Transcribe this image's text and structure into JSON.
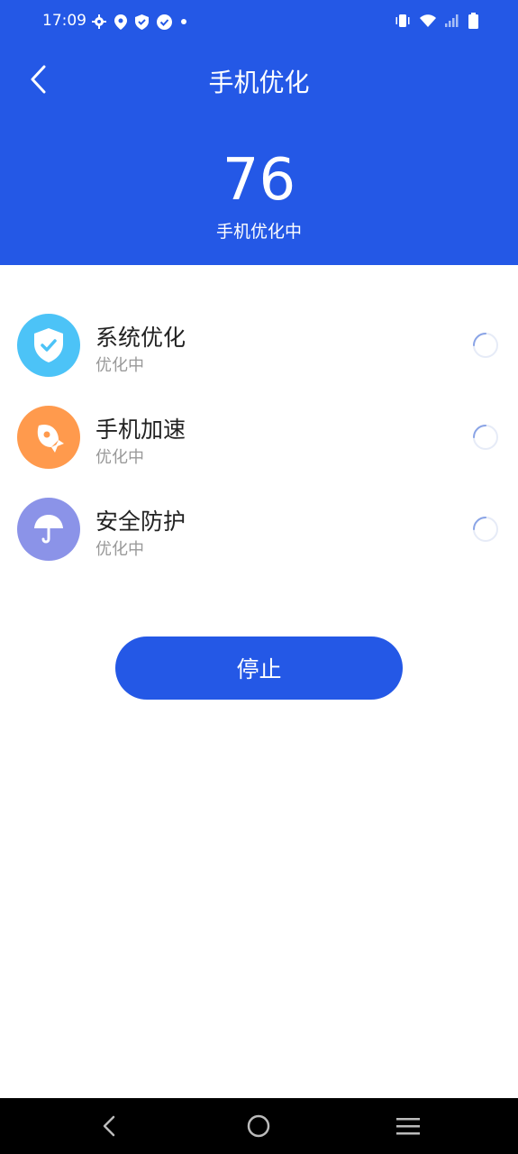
{
  "status_bar": {
    "time": "17:09"
  },
  "header": {
    "title": "手机优化",
    "score": "76",
    "score_caption": "手机优化中"
  },
  "items": [
    {
      "title": "系统优化",
      "status": "优化中",
      "icon": "shield-check-icon",
      "color": "#4cc3f7"
    },
    {
      "title": "手机加速",
      "status": "优化中",
      "icon": "rocket-icon",
      "color": "#ff9a4d"
    },
    {
      "title": "安全防护",
      "status": "优化中",
      "icon": "umbrella-icon",
      "color": "#8b93e8"
    }
  ],
  "stop_button": {
    "label": "停止"
  },
  "colors": {
    "primary": "#2458e6"
  }
}
